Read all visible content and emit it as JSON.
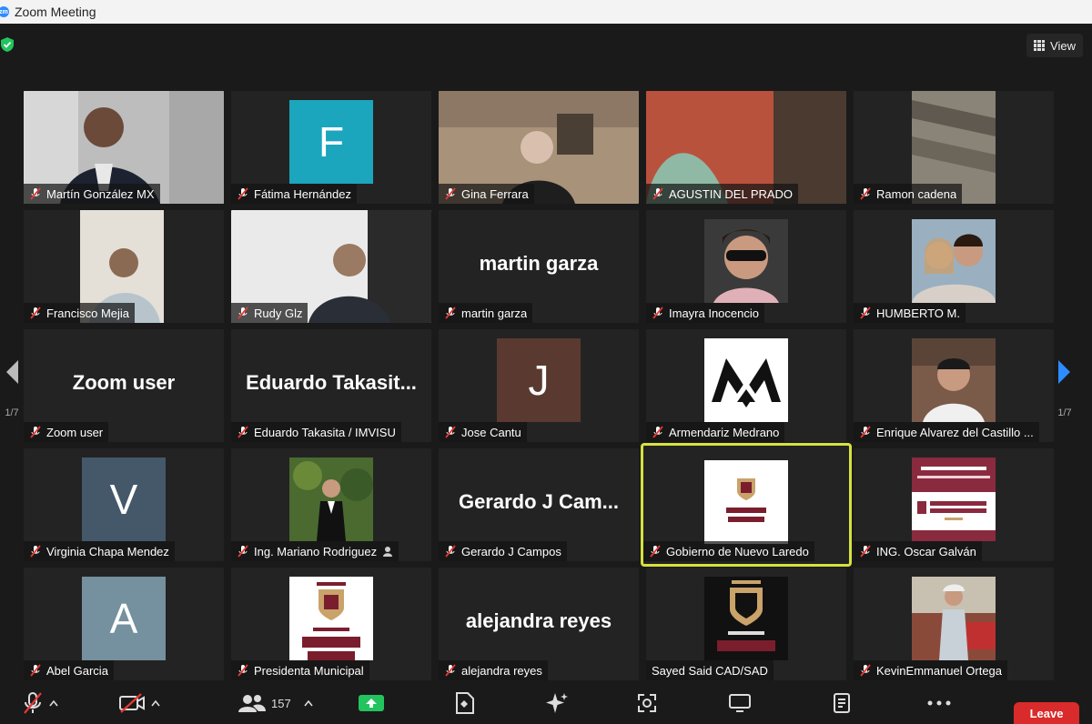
{
  "window": {
    "title": "Zoom Meeting"
  },
  "header": {
    "view_label": "View"
  },
  "pagination": {
    "left": "1/7",
    "right": "1/7"
  },
  "colors": {
    "accent_blue": "#2d8cff",
    "active_speaker": "#d6e23e",
    "leave_red": "#d92b2b",
    "mute_red": "#e53935"
  },
  "tiles": [
    {
      "name": "Martín González MX",
      "kind": "photo"
    },
    {
      "name": "Fátima Hernández",
      "kind": "avatar",
      "initial": "F",
      "color": "#1ba6bd"
    },
    {
      "name": "Gina Ferrara",
      "kind": "photo"
    },
    {
      "name": "AGUSTIN DEL PRADO",
      "kind": "photo"
    },
    {
      "name": "Ramon cadena",
      "kind": "photo"
    },
    {
      "name": "Francisco Mejia",
      "kind": "photo"
    },
    {
      "name": "Rudy Glz",
      "kind": "photo"
    },
    {
      "name": "martin garza",
      "kind": "text",
      "big": "martin garza"
    },
    {
      "name": "Imayra Inocencio",
      "kind": "photo"
    },
    {
      "name": "HUMBERTO M.",
      "kind": "photo"
    },
    {
      "name": "Zoom user",
      "kind": "text",
      "big": "Zoom user"
    },
    {
      "name": "Eduardo Takasita / IMVISU",
      "kind": "text",
      "big": "Eduardo  Takasit..."
    },
    {
      "name": "Jose Cantu",
      "kind": "avatar",
      "initial": "J",
      "color": "#5a3a30"
    },
    {
      "name": "Armendariz Medrano",
      "kind": "logo"
    },
    {
      "name": "Enrique Alvarez del Castillo ...",
      "kind": "photo"
    },
    {
      "name": "Virginia Chapa Mendez",
      "kind": "avatar",
      "initial": "V",
      "color": "#44586a"
    },
    {
      "name": "Ing. Mariano Rodriguez",
      "kind": "photo"
    },
    {
      "name": "Gerardo  J Campos",
      "kind": "text",
      "big": "Gerardo  J Cam..."
    },
    {
      "name": "Gobierno de Nuevo Laredo",
      "kind": "logo"
    },
    {
      "name": "ING. Oscar Galván",
      "kind": "logo"
    },
    {
      "name": "Abel Garcia",
      "kind": "avatar",
      "initial": "A",
      "color": "#75909e"
    },
    {
      "name": "Presidenta Municipal",
      "kind": "logo"
    },
    {
      "name": "alejandra reyes",
      "kind": "text",
      "big": "alejandra reyes"
    },
    {
      "name": "Sayed Said CAD/SAD",
      "kind": "logo"
    },
    {
      "name": "KevinEmmanuel Ortega",
      "kind": "photo"
    }
  ],
  "toolbar": {
    "participants_count": "157",
    "leave_label": "Leave"
  }
}
